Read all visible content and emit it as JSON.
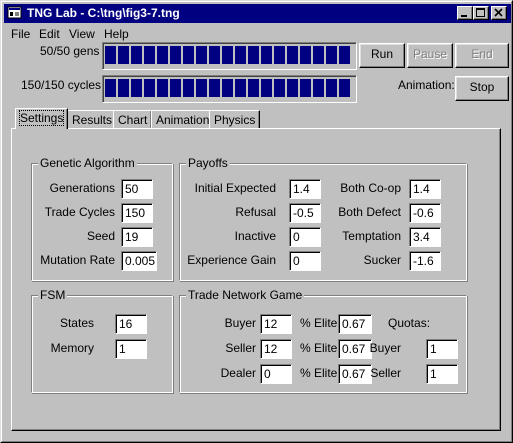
{
  "window": {
    "title": "TNG Lab - C:\\tng\\fig3-7.tng",
    "app_icon": "tng-app-icon",
    "controls": [
      "minimize-icon",
      "maximize-icon",
      "close-icon"
    ]
  },
  "menu": {
    "file": "File",
    "edit": "Edit",
    "view": "View",
    "help": "Help"
  },
  "progress": {
    "gens_label": "50/50 gens",
    "gens_fraction": 1.0,
    "cycles_label": "150/150 cycles",
    "cycles_fraction": 1.0
  },
  "buttons": {
    "run": "Run",
    "pause": "Pause",
    "end": "End",
    "stop": "Stop",
    "animation_label": "Animation:"
  },
  "tabs": [
    {
      "label": "Settings",
      "active": true
    },
    {
      "label": "Results",
      "active": false
    },
    {
      "label": "Chart",
      "active": false
    },
    {
      "label": "Animation",
      "active": false
    },
    {
      "label": "Physics",
      "active": false
    }
  ],
  "genetic_algorithm": {
    "title": "Genetic Algorithm",
    "generations_label": "Generations",
    "generations": "50",
    "trade_cycles_label": "Trade Cycles",
    "trade_cycles": "150",
    "seed_label": "Seed",
    "seed": "19",
    "mutation_rate_label": "Mutation Rate",
    "mutation_rate": "0.005"
  },
  "payoffs": {
    "title": "Payoffs",
    "initial_expected_label": "Initial Expected",
    "initial_expected": "1.4",
    "refusal_label": "Refusal",
    "refusal": "-0.5",
    "inactive_label": "Inactive",
    "inactive": "0",
    "experience_gain_label": "Experience Gain",
    "experience_gain": "0",
    "both_coop_label": "Both Co-op",
    "both_coop": "1.4",
    "both_defect_label": "Both Defect",
    "both_defect": "-0.6",
    "temptation_label": "Temptation",
    "temptation": "3.4",
    "sucker_label": "Sucker",
    "sucker": "-1.6"
  },
  "fsm": {
    "title": "FSM",
    "states_label": "States",
    "states": "16",
    "memory_label": "Memory",
    "memory": "1"
  },
  "tng": {
    "title": "Trade Network Game",
    "buyer_label": "Buyer",
    "buyer": "12",
    "seller_label": "Seller",
    "seller": "12",
    "dealer_label": "Dealer",
    "dealer": "0",
    "elite_label": "% Elite",
    "buyer_elite": "0.67",
    "seller_elite": "0.67",
    "dealer_elite": "0.67",
    "quotas_label": "Quotas:",
    "quota_buyer_label": "Buyer",
    "quota_buyer": "1",
    "quota_seller_label": "Seller",
    "quota_seller": "1"
  }
}
